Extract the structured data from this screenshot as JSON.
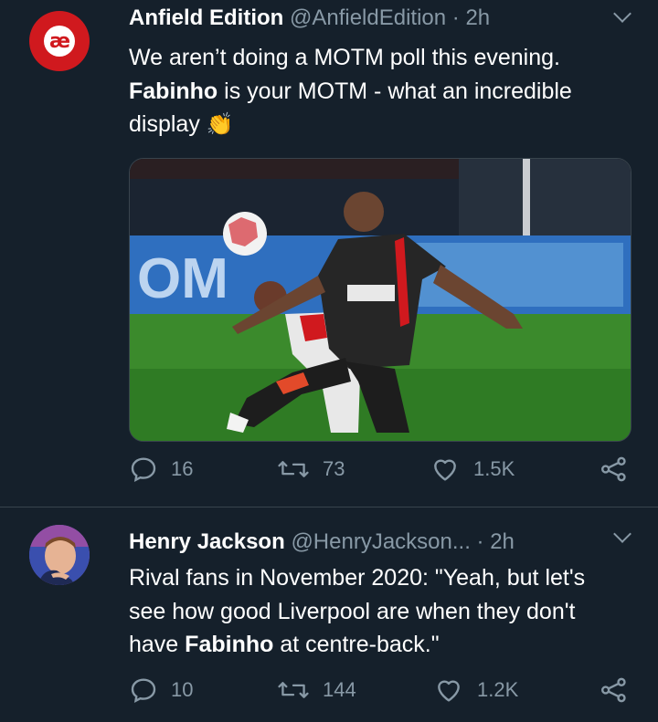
{
  "tweets": [
    {
      "name": "Anfield Edition",
      "handle": "@AnfieldEdition",
      "time": "· 2h",
      "avatar_text": "æ",
      "text": {
        "line1": "We aren’t doing a MOTM poll this evening.",
        "bold": "Fabinho",
        "line2_rest": " is your MOTM - what an incredible",
        "line3": "display",
        "emoji": "👏"
      },
      "replies": "16",
      "retweets": "73",
      "likes": "1.5K"
    },
    {
      "name": "Henry Jackson",
      "handle": "@HenryJackson...",
      "time": "· 2h",
      "text": {
        "line1": "Rival fans in November 2020: \"Yeah, but let's",
        "line2": "see how good Liverpool are when they don't",
        "line3_pre": "have ",
        "bold": "Fabinho",
        "line3_post": " at centre-back.\""
      },
      "replies": "10",
      "retweets": "144",
      "likes": "1.2K"
    }
  ],
  "colors": {
    "background": "#15202b",
    "secondary_text": "#8899a6",
    "divider": "#38444d",
    "brand_red": "#d0191e"
  }
}
